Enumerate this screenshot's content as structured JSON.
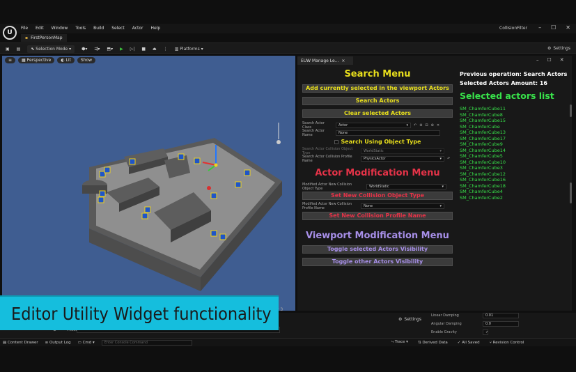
{
  "menu": [
    "File",
    "Edit",
    "Window",
    "Tools",
    "Build",
    "Select",
    "Actor",
    "Help"
  ],
  "window": {
    "title": "CollisionFilter",
    "controls": [
      "–",
      "☐",
      "✕"
    ]
  },
  "map_tab": "FirstPersonMap",
  "toolbar": {
    "mode": "Selection Mode",
    "platforms": "Platforms",
    "settings": "Settings"
  },
  "viewport": {
    "perspective": "Perspective",
    "lit": "Lit",
    "show": "Show"
  },
  "editor_tab": "EUW Manage Le...",
  "search_menu": {
    "title": "Search Menu",
    "btn_add": "Add currently selected in the viewport Actors",
    "btn_search": "Search Actors",
    "btn_clear": "Clear selected Actors",
    "class_label": "Search Actor Class",
    "class_value": "Actor",
    "name_label": "Search Actor Name",
    "name_value": "None",
    "obj_type_check": "Search Using Object Type",
    "obj_type_label": "Search Actor Collision Object Type",
    "obj_type_value": "WorldStatic",
    "profile_label": "Search Actor Collision Profile Name",
    "profile_value": "PhysicsActor"
  },
  "actor_menu": {
    "title": "Actor Modification Menu",
    "obj_label": "Modified Actor New Collision Object Type",
    "obj_value": "WorldStatic",
    "btn_set_obj": "Set New Collision Object Type",
    "profile_label": "Modified Actor New Collision Profile Name",
    "profile_value": "None",
    "btn_set_profile": "Set New Collision Profile Name"
  },
  "viewport_menu": {
    "title": "Viewport Modification Menu",
    "btn_toggle_sel": "Toggle selected Actors Visibility",
    "btn_toggle_other": "Toggle other Actors Visibility"
  },
  "info": {
    "prev_op": "Previous operation: Search Actors",
    "amount": "Selected Actors Amount: 16",
    "list_title": "Selected actors list",
    "actors": [
      "SM_ChamferCube11",
      "SM_ChamferCube8",
      "SM_ChamferCube15",
      "SM_ChamferCube",
      "SM_ChamferCube13",
      "SM_ChamferCube17",
      "SM_ChamferCube9",
      "SM_ChamferCube14",
      "SM_ChamferCube5",
      "SM_ChamferCube10",
      "SM_ChamferCube3",
      "SM_ChamferCube12",
      "SM_ChamferCube16",
      "SM_ChamferCube18",
      "SM_ChamferCube4",
      "SM_ChamferCube2"
    ]
  },
  "bottom": {
    "outliner": "CollisionFilter",
    "filters": "Filters",
    "settings": "Settings",
    "tab_fragment": "r 3"
  },
  "details": [
    {
      "label": "Linear Damping",
      "value": "0.01"
    },
    {
      "label": "Angular Damping",
      "value": "0.0"
    },
    {
      "label": "Enable Gravity",
      "value": "✓"
    }
  ],
  "status": {
    "content_drawer": "Content Drawer",
    "output_log": "Output Log",
    "cmd": "Cmd",
    "console_placeholder": "Enter Console Command",
    "trace": "Trace",
    "derived": "Derived Data",
    "saved": "All Saved",
    "revision": "Revision Control"
  },
  "caption": "Editor Utility Widget functionality"
}
